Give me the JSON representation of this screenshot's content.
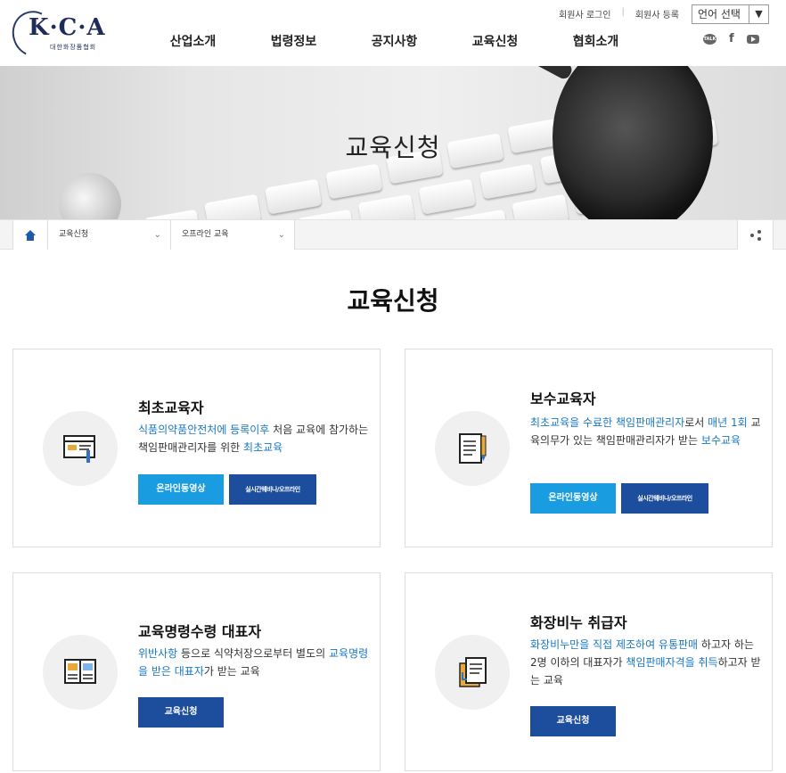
{
  "header": {
    "logo_text": "K·C·A",
    "logo_sub": "대한화장품협회",
    "util_links": [
      "회원사 로그인",
      "회원사 등록"
    ],
    "language_label": "언어 선택",
    "nav": [
      "산업소개",
      "법령정보",
      "공지사항",
      "교육신청",
      "협회소개"
    ],
    "sns": [
      "talk-icon",
      "facebook-icon",
      "youtube-icon"
    ]
  },
  "banner": {
    "title": "교육신청"
  },
  "breadcrumb": {
    "level1": "교육신청",
    "level2": "오프라인 교육"
  },
  "page": {
    "title": "교육신청"
  },
  "cards": [
    {
      "title": "최초교육자",
      "desc_parts": [
        {
          "t": "식품의약품안전처에 등록이후",
          "hl": true
        },
        {
          "t": " 처음 교육에 참가하는 책임판매관리자를 위한 ",
          "hl": false
        },
        {
          "t": "최초교육",
          "hl": true
        }
      ],
      "buttons": [
        "온라인동영상",
        "실시간웨비나/오프라인"
      ]
    },
    {
      "title": "보수교육자",
      "desc_parts": [
        {
          "t": "최초교육을 수료한 책임판매관리자",
          "hl": true
        },
        {
          "t": "로서 ",
          "hl": false
        },
        {
          "t": "매년 1회",
          "hl": true
        },
        {
          "t": " 교육의무가 있는 책임판매관리자가 받는 ",
          "hl": false
        },
        {
          "t": "보수교육",
          "hl": true
        }
      ],
      "buttons": [
        "온라인동영상",
        "실시간웨비나/오프라인"
      ]
    },
    {
      "title": "교육명령수령 대표자",
      "desc_parts": [
        {
          "t": "위반사항",
          "hl": true
        },
        {
          "t": " 등으로 식약처장으로부터 별도의 ",
          "hl": false
        },
        {
          "t": "교육명령을 받은 대표자",
          "hl": true
        },
        {
          "t": "가 받는 교육",
          "hl": false
        }
      ],
      "buttons": [
        "교육신청"
      ]
    },
    {
      "title": "화장비누 취급자",
      "desc_parts": [
        {
          "t": "화장비누만을 직접 제조하여 유통판매",
          "hl": true
        },
        {
          "t": " 하고자 하는 2명 이하의 대표자가 ",
          "hl": false
        },
        {
          "t": "책임판매자격을 취득",
          "hl": true
        },
        {
          "t": "하고자 받는 교육",
          "hl": false
        }
      ],
      "buttons": [
        "교육신청"
      ]
    }
  ],
  "colors": {
    "highlight": "#1a78c2",
    "button_light": "#1a9ce0",
    "button_dark": "#1d4e9e"
  }
}
